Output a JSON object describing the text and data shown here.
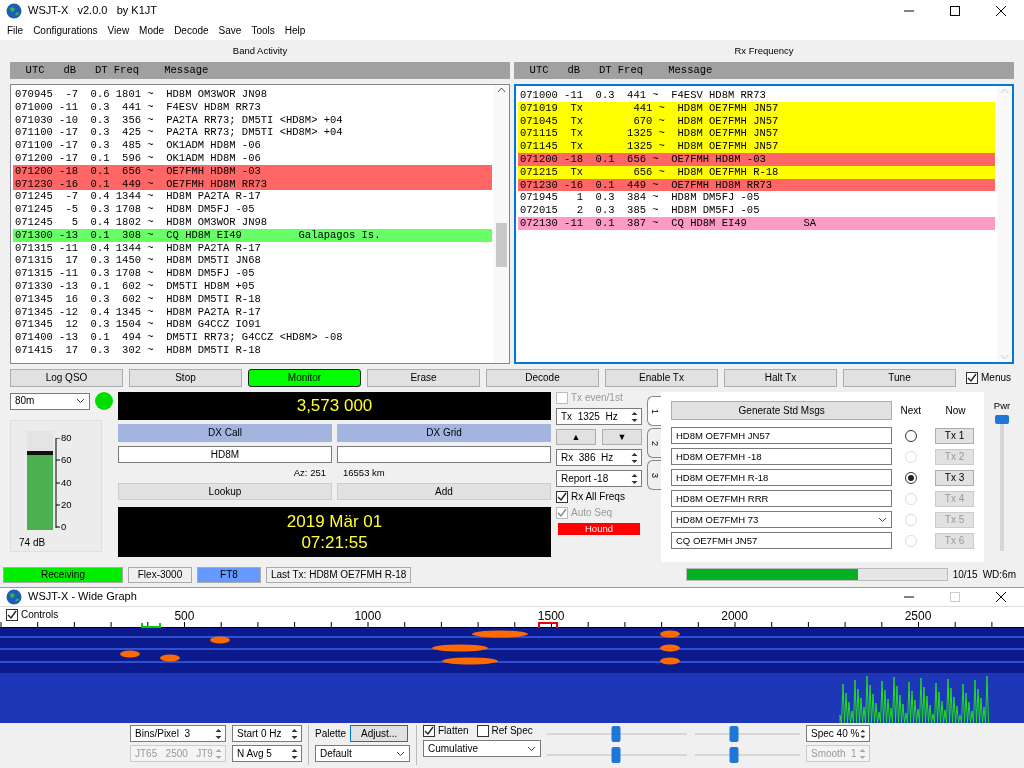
{
  "window": {
    "title": "WSJT-X   v2.0.0   by K1JT"
  },
  "menu": [
    "File",
    "Configurations",
    "View",
    "Mode",
    "Decode",
    "Save",
    "Tools",
    "Help"
  ],
  "band_activity": {
    "title": "Band Activity",
    "header": "  UTC   dB   DT Freq    Message",
    "rows": [
      {
        "text": "070945  -7  0.6 1801 ~  HD8M OM3WOR JN98"
      },
      {
        "text": "071000 -11  0.3  441 ~  F4ESV HD8M RR73"
      },
      {
        "text": "071030 -10  0.3  356 ~  PA2TA RR73; DM5TI <HD8M> +04"
      },
      {
        "text": "071100 -17  0.3  425 ~  PA2TA RR73; DM5TI <HD8M> +04"
      },
      {
        "text": "071100 -17  0.3  485 ~  OK1ADM HD8M -06"
      },
      {
        "text": "071200 -17  0.1  596 ~  OK1ADM HD8M -06"
      },
      {
        "text": "071200 -18  0.1  656 ~  OE7FMH HD8M -03",
        "color": "#ff6666"
      },
      {
        "text": "071230 -16  0.1  449 ~  OE7FMH HD8M RR73",
        "color": "#ff6666"
      },
      {
        "text": "071245  -7  0.4 1344 ~  HD8M PA2TA R-17"
      },
      {
        "text": "071245  -5  0.3 1708 ~  HD8M DM5FJ -05"
      },
      {
        "text": "071245   5  0.4 1802 ~  HD8M OM3WOR JN98"
      },
      {
        "text": "071300 -13  0.1  308 ~  CQ HD8M EI49         Galapagos Is.",
        "color": "#66ff66"
      },
      {
        "text": "071315 -11  0.4 1344 ~  HD8M PA2TA R-17"
      },
      {
        "text": "071315  17  0.3 1450 ~  HD8M DM5TI JN68"
      },
      {
        "text": "071315 -11  0.3 1708 ~  HD8M DM5FJ -05"
      },
      {
        "text": "071330 -13  0.1  602 ~  DM5TI HD8M +05"
      },
      {
        "text": "071345  16  0.3  602 ~  HD8M DM5TI R-18"
      },
      {
        "text": "071345 -12  0.4 1345 ~  HD8M PA2TA R-17"
      },
      {
        "text": "071345  12  0.3 1504 ~  HD8M G4CCZ IO91"
      },
      {
        "text": "071400 -13  0.1  494 ~  DM5TI RR73; G4CCZ <HD8M> -08"
      },
      {
        "text": "071415  17  0.3  302 ~  HD8M DM5TI R-18"
      }
    ]
  },
  "rx_frequency": {
    "title": "Rx Frequency",
    "header": "  UTC   dB   DT Freq    Message",
    "rows": [
      {
        "text": "071000 -11  0.3  441 ~  F4ESV HD8M RR73"
      },
      {
        "text": "071019  Tx        441 ~  HD8M OE7FMH JN57",
        "color": "#ffff00"
      },
      {
        "text": "071045  Tx        670 ~  HD8M OE7FMH JN57",
        "color": "#ffff00"
      },
      {
        "text": "071115  Tx       1325 ~  HD8M OE7FMH JN57",
        "color": "#ffff00"
      },
      {
        "text": "071145  Tx       1325 ~  HD8M OE7FMH JN57",
        "color": "#ffff00"
      },
      {
        "text": "071200 -18  0.1  656 ~  OE7FMH HD8M -03",
        "color": "#ff6666"
      },
      {
        "text": "071215  Tx        656 ~  HD8M OE7FMH R-18",
        "color": "#ffff00"
      },
      {
        "text": "071230 -16  0.1  449 ~  OE7FMH HD8M RR73",
        "color": "#ff6666"
      },
      {
        "text": "071945   1  0.3  384 ~  HD8M DM5FJ -05"
      },
      {
        "text": "072015   2  0.3  385 ~  HD8M DM5FJ -05"
      },
      {
        "text": "072130 -11  0.1  387 ~  CQ HD8M EI49         SA",
        "color": "#ff99c8"
      }
    ]
  },
  "buttons": [
    {
      "label": "Log QSO",
      "active": false
    },
    {
      "label": "Stop",
      "active": false
    },
    {
      "label": "Monitor",
      "active": true
    },
    {
      "label": "Erase",
      "active": false
    },
    {
      "label": "Decode",
      "active": false
    },
    {
      "label": "Enable Tx",
      "active": false
    },
    {
      "label": "Halt Tx",
      "active": false
    },
    {
      "label": "Tune",
      "active": false
    }
  ],
  "menus_option": {
    "label": "Menus",
    "checked": true
  },
  "band": "80m",
  "frequency": "3,573 000",
  "dx_call": {
    "label": "DX Call",
    "value": "HD8M"
  },
  "dx_grid": {
    "label": "DX Grid"
  },
  "azimuth": "Az: 251",
  "distance": "16553 km",
  "lookup_button": "Lookup",
  "add_button": "Add",
  "date": "2019 Mär 01",
  "time": "07:21:55",
  "signal_meter": {
    "level": 0.8,
    "ticks": [
      "80",
      "60",
      "40",
      "20",
      "0"
    ],
    "reading": "74 dB"
  },
  "tx_controls": [
    {
      "kind": "checkbox",
      "label": "Tx even/1st",
      "checked": false,
      "disabled": true
    },
    {
      "kind": "spin",
      "text": "Tx  1325  Hz"
    },
    {
      "kind": "arrows",
      "up": "▲",
      "down": "▼"
    },
    {
      "kind": "spin",
      "text": "Rx  386  Hz"
    },
    {
      "kind": "spin",
      "text": "Report -18"
    },
    {
      "kind": "checkbox",
      "label": "Rx All Freqs",
      "checked": true,
      "disabled": false
    },
    {
      "kind": "checkbox",
      "label": "Auto Seq",
      "checked": true,
      "disabled": true
    },
    {
      "kind": "indicator",
      "text": "Hound"
    }
  ],
  "tx_tabs": [
    {
      "label": "1",
      "selected": true
    },
    {
      "label": "2",
      "selected": false
    },
    {
      "label": "3",
      "selected": false
    }
  ],
  "tx_panel": {
    "generate_button": "Generate Std Msgs",
    "next_label": "Next",
    "now_label": "Now",
    "messages": [
      {
        "kind": "field",
        "text": "HD8M OE7FMH JN57",
        "selected": false,
        "disabled": false,
        "button": "Tx 1"
      },
      {
        "kind": "field",
        "text": "HD8M OE7FMH -18",
        "selected": false,
        "disabled": true,
        "button": "Tx 2"
      },
      {
        "kind": "field",
        "text": "HD8M OE7FMH R-18",
        "selected": true,
        "disabled": false,
        "button": "Tx 3"
      },
      {
        "kind": "field",
        "text": "HD8M OE7FMH RRR",
        "selected": false,
        "disabled": true,
        "button": "Tx 4"
      },
      {
        "kind": "combo",
        "text": "HD8M OE7FMH 73",
        "selected": false,
        "disabled": true,
        "button": "Tx 5"
      },
      {
        "kind": "field",
        "text": "CQ OE7FMH JN57",
        "selected": false,
        "disabled": true,
        "button": "Tx 6"
      }
    ]
  },
  "power": {
    "label": "Pwr",
    "level": 1
  },
  "status_bar": {
    "receiving": "Receiving",
    "rig": "Flex-3000",
    "mode": "FT8",
    "last_tx": "Last Tx: HD8M OE7FMH R-18",
    "progress": {
      "level": 0.66
    },
    "period": "10/15",
    "watchdog": "WD:6m"
  },
  "wide_graph": {
    "title": "WSJT-X - Wide Graph",
    "controls": {
      "label": "Controls",
      "checked": true
    },
    "axis_labels": [
      "500",
      "1000",
      "1500",
      "2000",
      "2500"
    ],
    "bins_per_pixel": {
      "text": "Bins/Pixel  3",
      "disabled": false
    },
    "start": {
      "text": "Start 0 Hz",
      "disabled": false
    },
    "palette_label": "Palette",
    "adjust_button": "Adjust...",
    "flatten": {
      "label": "Flatten",
      "checked": true
    },
    "ref_spec": {
      "label": "Ref Spec",
      "checked": false
    },
    "spec": {
      "text": "Spec 40 %",
      "disabled": false
    },
    "modes": {
      "text": "JT65   2500   JT9",
      "disabled": true
    },
    "n_avg": {
      "text": "N Avg 5",
      "disabled": false
    },
    "palette": "Default",
    "averaging": "Cumulative",
    "smooth": {
      "text": "Smooth  1",
      "disabled": true
    },
    "sliders": [
      {
        "level": 0.49
      },
      {
        "level": 0.37
      },
      {
        "level": 0.49
      },
      {
        "level": 0.37
      }
    ]
  }
}
